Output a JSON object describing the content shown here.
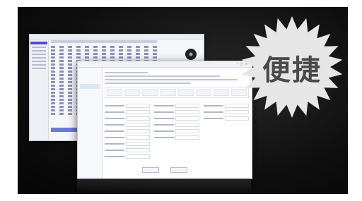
{
  "badge": {
    "text": "便捷"
  },
  "colors": {
    "background": "#0f0f0f",
    "accent": "#5a49c8",
    "badge_fill": "#e6e6e6"
  },
  "main_window": {
    "nav_active_index": 2
  },
  "back_window": {
    "progress": 0.35
  }
}
